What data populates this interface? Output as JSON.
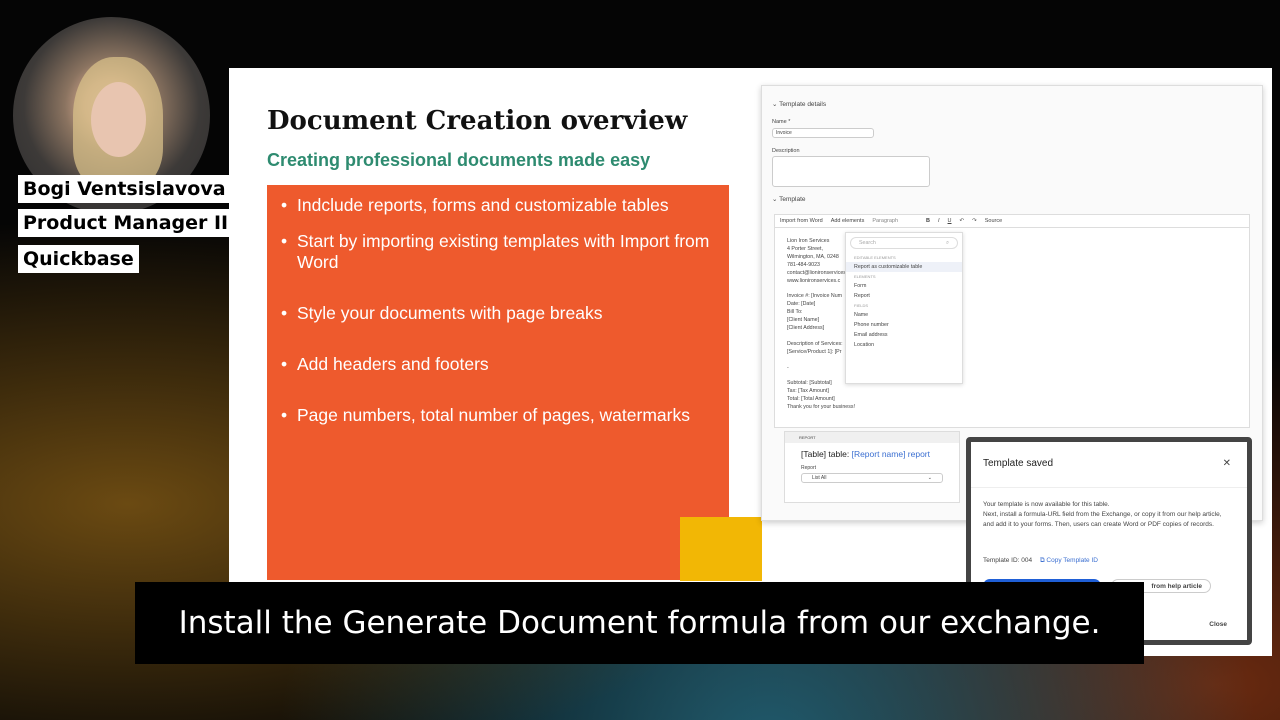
{
  "presenter": {
    "name": "Bogi Ventsislavova",
    "role": "Product Manager II",
    "company": "Quickbase"
  },
  "slide": {
    "title": "Document Creation overview",
    "subtitle": "Creating professional documents made easy",
    "bullets": [
      "Indclude reports, forms and customizable tables",
      "Start by importing existing templates with Import from Word",
      "Style your documents with page breaks",
      "Add headers and footers",
      "Page numbers, total number of pages, watermarks"
    ]
  },
  "app": {
    "section_details": "Template details",
    "name_label": "Name *",
    "name_value": "Invoice",
    "description_label": "Description",
    "section_template": "Template",
    "toolbar": {
      "import": "Import from Word",
      "add_elements": "Add elements",
      "paragraph": "Paragraph",
      "source": "Source"
    },
    "document_text": "Lion Iron Services\n4 Porter Street,\nWilmington, MA, 0248\n781-484-9023\ncontact@lionironservices\nwww.lionironservices.c\n\nInvoice #: [Invoice Num\nDate: [Date]\nBill To:\n[Client Name]\n[Client Address]\n\nDescription of Services:\n[Service/Product 1]: [Pr\n\n-\n\nSubtotal: [Subtotal]\nTax: [Tax Amount]\nTotal: [Total Amount]\nThank you for your business!",
    "dropdown": {
      "search_placeholder": "Search",
      "editable_header": "EDITABLE ELEMENTS",
      "editable_item": "Report as customizable table",
      "elements_header": "ELEMENTS",
      "elements": [
        "Form",
        "Report"
      ],
      "fields_header": "FIELDS",
      "fields": [
        "Name",
        "Phone number",
        "Email address",
        "Location"
      ]
    },
    "report_block": {
      "tag": "REPORT",
      "heading_prefix": "[Table] table:",
      "heading_link": "[Report name] report",
      "label": "Report",
      "value": "List All"
    }
  },
  "modal": {
    "title": "Template saved",
    "body1": "Your template is now available for this table.",
    "body2": "Next, install a formula-URL field from the Exchange, or copy it from our help article, and add it to your forms. Then, users can create Word or PDF copies of records.",
    "template_id": "Template ID: 004",
    "copy_label": "Copy Template ID",
    "help_button": "from help article",
    "close": "Close"
  },
  "caption": "Install the Generate Document formula from our exchange.",
  "colors": {
    "orange": "#ee5a2d",
    "green": "#2e8b70",
    "yellow": "#f2b705",
    "link": "#3b6fd1"
  }
}
